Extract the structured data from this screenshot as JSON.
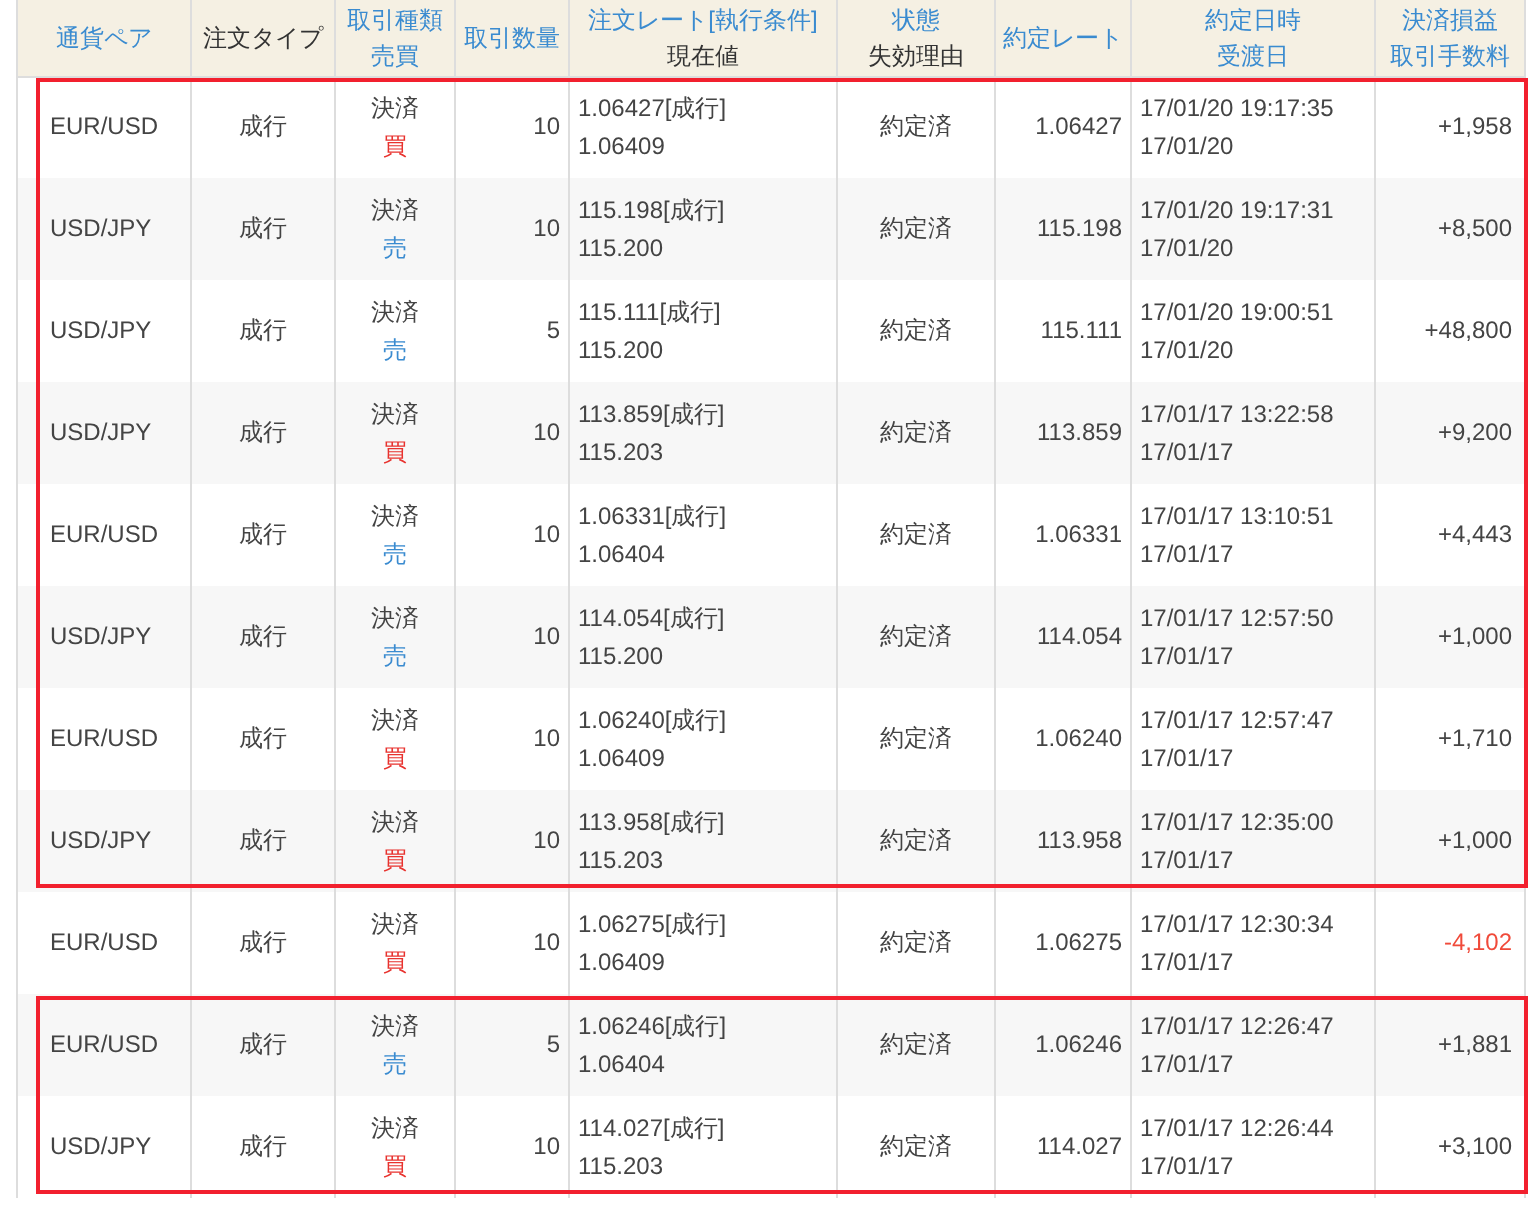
{
  "table": {
    "columns": [
      {
        "lines": [
          {
            "text": "通貨ペア",
            "link": true
          }
        ]
      },
      {
        "lines": [
          {
            "text": "注文タイプ",
            "link": false
          }
        ]
      },
      {
        "lines": [
          {
            "text": "取引種類",
            "link": true
          },
          {
            "text": "売買",
            "link": true
          }
        ]
      },
      {
        "lines": [
          {
            "text": "取引数量",
            "link": true
          }
        ]
      },
      {
        "lines": [
          {
            "text": "注文レート[執行条件]",
            "link": true
          },
          {
            "text": "現在値",
            "link": false
          }
        ]
      },
      {
        "lines": [
          {
            "text": "状態",
            "link": true
          },
          {
            "text": "失効理由",
            "link": false
          }
        ]
      },
      {
        "lines": [
          {
            "text": "約定レート",
            "link": true
          }
        ]
      },
      {
        "lines": [
          {
            "text": "約定日時",
            "link": true
          },
          {
            "text": "受渡日",
            "link": true
          }
        ]
      },
      {
        "lines": [
          {
            "text": "決済損益",
            "link": true
          },
          {
            "text": "取引手数料",
            "link": true
          }
        ]
      }
    ],
    "rows": [
      {
        "pair": "EUR/USD",
        "order_type": "成行",
        "trade_type": "決済",
        "side": {
          "text": "買",
          "kind": "buy"
        },
        "quantity": "10",
        "order_rate": "1.06427[成行]",
        "current": "1.06409",
        "status": "約定済",
        "fill_rate": "1.06427",
        "fill_time": "17/01/20 19:17:35",
        "settle_date": "17/01/20",
        "pnl": "+1,958",
        "loss": false,
        "highlighted": true
      },
      {
        "pair": "USD/JPY",
        "order_type": "成行",
        "trade_type": "決済",
        "side": {
          "text": "売",
          "kind": "sell"
        },
        "quantity": "10",
        "order_rate": "115.198[成行]",
        "current": "115.200",
        "status": "約定済",
        "fill_rate": "115.198",
        "fill_time": "17/01/20 19:17:31",
        "settle_date": "17/01/20",
        "pnl": "+8,500",
        "loss": false,
        "highlighted": true
      },
      {
        "pair": "USD/JPY",
        "order_type": "成行",
        "trade_type": "決済",
        "side": {
          "text": "売",
          "kind": "sell"
        },
        "quantity": "5",
        "order_rate": "115.111[成行]",
        "current": "115.200",
        "status": "約定済",
        "fill_rate": "115.111",
        "fill_time": "17/01/20 19:00:51",
        "settle_date": "17/01/20",
        "pnl": "+48,800",
        "loss": false,
        "highlighted": true
      },
      {
        "pair": "USD/JPY",
        "order_type": "成行",
        "trade_type": "決済",
        "side": {
          "text": "買",
          "kind": "buy"
        },
        "quantity": "10",
        "order_rate": "113.859[成行]",
        "current": "115.203",
        "status": "約定済",
        "fill_rate": "113.859",
        "fill_time": "17/01/17 13:22:58",
        "settle_date": "17/01/17",
        "pnl": "+9,200",
        "loss": false,
        "highlighted": true
      },
      {
        "pair": "EUR/USD",
        "order_type": "成行",
        "trade_type": "決済",
        "side": {
          "text": "売",
          "kind": "sell"
        },
        "quantity": "10",
        "order_rate": "1.06331[成行]",
        "current": "1.06404",
        "status": "約定済",
        "fill_rate": "1.06331",
        "fill_time": "17/01/17 13:10:51",
        "settle_date": "17/01/17",
        "pnl": "+4,443",
        "loss": false,
        "highlighted": true
      },
      {
        "pair": "USD/JPY",
        "order_type": "成行",
        "trade_type": "決済",
        "side": {
          "text": "売",
          "kind": "sell"
        },
        "quantity": "10",
        "order_rate": "114.054[成行]",
        "current": "115.200",
        "status": "約定済",
        "fill_rate": "114.054",
        "fill_time": "17/01/17 12:57:50",
        "settle_date": "17/01/17",
        "pnl": "+1,000",
        "loss": false,
        "highlighted": true
      },
      {
        "pair": "EUR/USD",
        "order_type": "成行",
        "trade_type": "決済",
        "side": {
          "text": "買",
          "kind": "buy"
        },
        "quantity": "10",
        "order_rate": "1.06240[成行]",
        "current": "1.06409",
        "status": "約定済",
        "fill_rate": "1.06240",
        "fill_time": "17/01/17 12:57:47",
        "settle_date": "17/01/17",
        "pnl": "+1,710",
        "loss": false,
        "highlighted": true
      },
      {
        "pair": "USD/JPY",
        "order_type": "成行",
        "trade_type": "決済",
        "side": {
          "text": "買",
          "kind": "buy"
        },
        "quantity": "10",
        "order_rate": "113.958[成行]",
        "current": "115.203",
        "status": "約定済",
        "fill_rate": "113.958",
        "fill_time": "17/01/17 12:35:00",
        "settle_date": "17/01/17",
        "pnl": "+1,000",
        "loss": false,
        "highlighted": true
      },
      {
        "pair": "EUR/USD",
        "order_type": "成行",
        "trade_type": "決済",
        "side": {
          "text": "買",
          "kind": "buy"
        },
        "quantity": "10",
        "order_rate": "1.06275[成行]",
        "current": "1.06409",
        "status": "約定済",
        "fill_rate": "1.06275",
        "fill_time": "17/01/17 12:30:34",
        "settle_date": "17/01/17",
        "pnl": "-4,102",
        "loss": true,
        "highlighted": false
      },
      {
        "pair": "EUR/USD",
        "order_type": "成行",
        "trade_type": "決済",
        "side": {
          "text": "売",
          "kind": "sell"
        },
        "quantity": "5",
        "order_rate": "1.06246[成行]",
        "current": "1.06404",
        "status": "約定済",
        "fill_rate": "1.06246",
        "fill_time": "17/01/17 12:26:47",
        "settle_date": "17/01/17",
        "pnl": "+1,881",
        "loss": false,
        "highlighted": true
      },
      {
        "pair": "USD/JPY",
        "order_type": "成行",
        "trade_type": "決済",
        "side": {
          "text": "買",
          "kind": "buy"
        },
        "quantity": "10",
        "order_rate": "114.027[成行]",
        "current": "115.203",
        "status": "約定済",
        "fill_rate": "114.027",
        "fill_time": "17/01/17 12:26:44",
        "settle_date": "17/01/17",
        "pnl": "+3,100",
        "loss": false,
        "highlighted": true
      }
    ]
  }
}
